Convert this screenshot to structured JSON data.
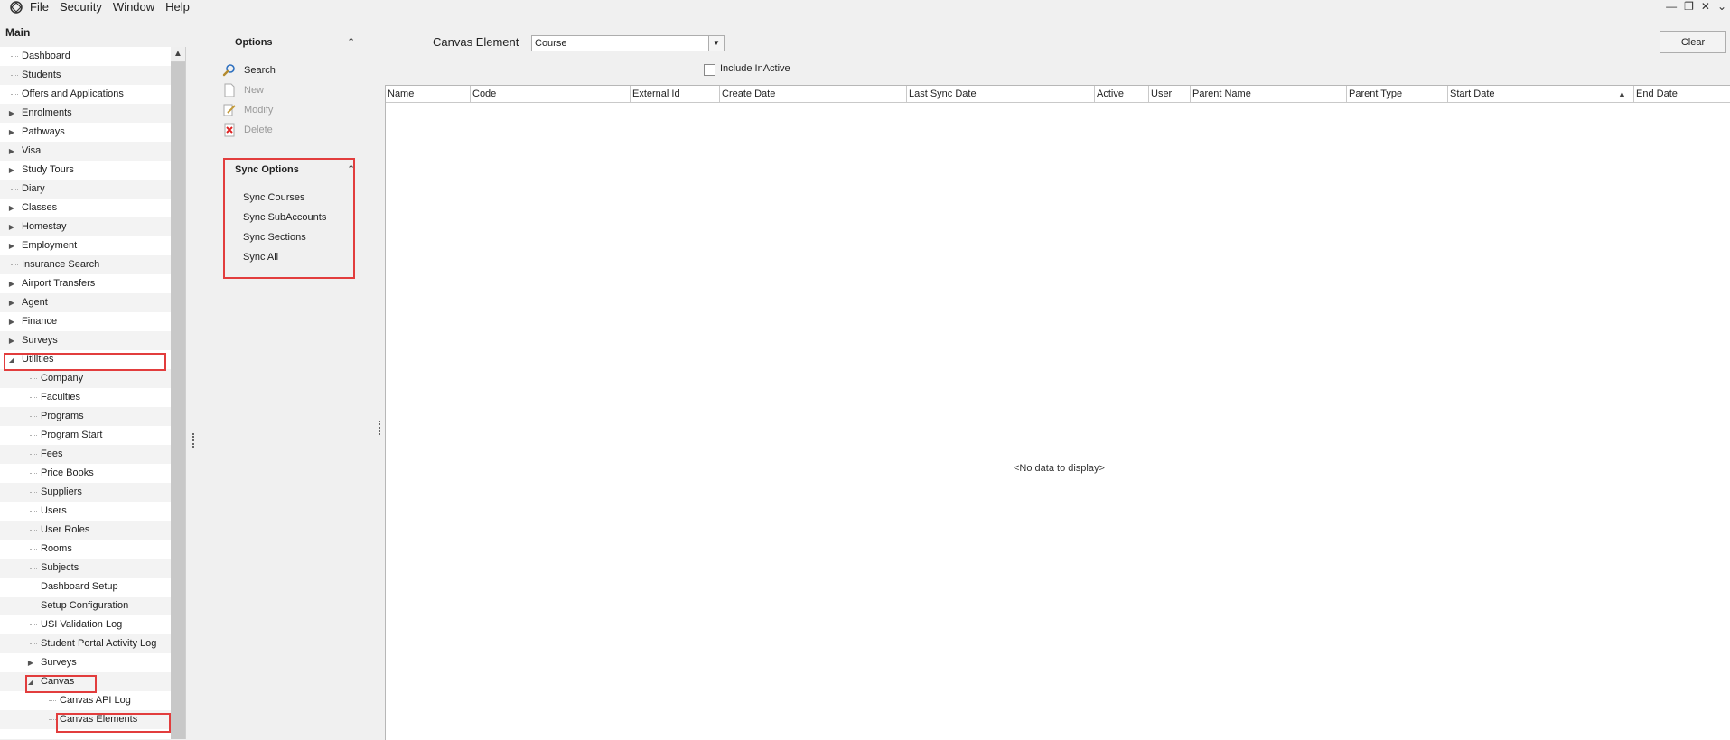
{
  "menu": {
    "items": [
      "File",
      "Security",
      "Window",
      "Help"
    ]
  },
  "window_controls": {
    "minimize": "—",
    "restore": "❐",
    "close": "✕",
    "more": "⌄"
  },
  "sidebar": {
    "title": "Main",
    "scroll_up": "▲",
    "items": [
      {
        "label": "Dashboard",
        "level": 0,
        "expander": ""
      },
      {
        "label": "Students",
        "level": 0,
        "expander": ""
      },
      {
        "label": "Offers and Applications",
        "level": 0,
        "expander": ""
      },
      {
        "label": "Enrolments",
        "level": 0,
        "expander": "collapsed"
      },
      {
        "label": "Pathways",
        "level": 0,
        "expander": "collapsed"
      },
      {
        "label": "Visa",
        "level": 0,
        "expander": "collapsed"
      },
      {
        "label": "Study Tours",
        "level": 0,
        "expander": "collapsed"
      },
      {
        "label": "Diary",
        "level": 0,
        "expander": ""
      },
      {
        "label": "Classes",
        "level": 0,
        "expander": "collapsed"
      },
      {
        "label": "Homestay",
        "level": 0,
        "expander": "collapsed"
      },
      {
        "label": "Employment",
        "level": 0,
        "expander": "collapsed"
      },
      {
        "label": "Insurance Search",
        "level": 0,
        "expander": ""
      },
      {
        "label": "Airport Transfers",
        "level": 0,
        "expander": "collapsed"
      },
      {
        "label": "Agent",
        "level": 0,
        "expander": "collapsed"
      },
      {
        "label": "Finance",
        "level": 0,
        "expander": "collapsed"
      },
      {
        "label": "Surveys",
        "level": 0,
        "expander": "collapsed"
      },
      {
        "label": "Utilities",
        "level": 0,
        "expander": "expanded"
      },
      {
        "label": "Company",
        "level": 1,
        "expander": ""
      },
      {
        "label": "Faculties",
        "level": 1,
        "expander": ""
      },
      {
        "label": "Programs",
        "level": 1,
        "expander": ""
      },
      {
        "label": "Program Start",
        "level": 1,
        "expander": ""
      },
      {
        "label": "Fees",
        "level": 1,
        "expander": ""
      },
      {
        "label": "Price Books",
        "level": 1,
        "expander": ""
      },
      {
        "label": "Suppliers",
        "level": 1,
        "expander": ""
      },
      {
        "label": "Users",
        "level": 1,
        "expander": ""
      },
      {
        "label": "User Roles",
        "level": 1,
        "expander": ""
      },
      {
        "label": "Rooms",
        "level": 1,
        "expander": ""
      },
      {
        "label": "Subjects",
        "level": 1,
        "expander": ""
      },
      {
        "label": "Dashboard Setup",
        "level": 1,
        "expander": ""
      },
      {
        "label": "Setup Configuration",
        "level": 1,
        "expander": ""
      },
      {
        "label": "USI Validation Log",
        "level": 1,
        "expander": ""
      },
      {
        "label": "Student Portal Activity Log",
        "level": 1,
        "expander": ""
      },
      {
        "label": "Surveys",
        "level": 1,
        "expander": "collapsed"
      },
      {
        "label": "Canvas",
        "level": 1,
        "expander": "expanded"
      },
      {
        "label": "Canvas API Log",
        "level": 2,
        "expander": ""
      },
      {
        "label": "Canvas Elements",
        "level": 2,
        "expander": ""
      }
    ]
  },
  "options": {
    "title": "Options",
    "collapse_glyph": "⌃",
    "actions": [
      {
        "label": "Search",
        "icon": "search-icon",
        "enabled": true
      },
      {
        "label": "New",
        "icon": "new-document-icon",
        "enabled": false
      },
      {
        "label": "Modify",
        "icon": "edit-icon",
        "enabled": false
      },
      {
        "label": "Delete",
        "icon": "delete-icon",
        "enabled": false
      }
    ]
  },
  "sync_options": {
    "title": "Sync Options",
    "collapse_glyph": "⌃",
    "actions": [
      "Sync Courses",
      "Sync SubAccounts",
      "Sync Sections",
      "Sync All"
    ]
  },
  "filter": {
    "label": "Canvas Element",
    "select_value": "Course",
    "dropdown_glyph": "▼",
    "include_inactive_label": "Include InActive",
    "include_inactive_checked": false,
    "clear_label": "Clear"
  },
  "grid": {
    "columns": [
      "Name",
      "Code",
      "External Id",
      "Create Date",
      "Last Sync Date",
      "Active",
      "User",
      "Parent Name",
      "Parent Type",
      "Start Date",
      "End Date"
    ],
    "sort_glyph": "▲",
    "empty_message": "<No data to display>"
  },
  "colors": {
    "highlight": "#e23d3d",
    "grid_border": "#c9c9c9"
  }
}
